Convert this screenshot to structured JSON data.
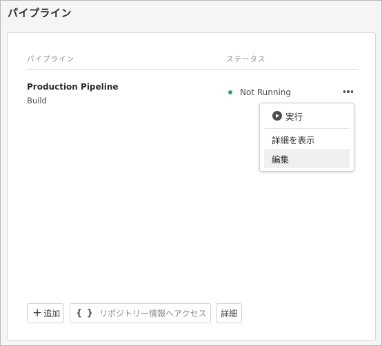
{
  "window": {
    "title": "パイプライン"
  },
  "table": {
    "columns": [
      "パイプライン",
      "ステータス"
    ]
  },
  "pipeline": {
    "name": "Production Pipeline",
    "subtitle": "Build",
    "status": "Not Running",
    "status_color": "#2d9d78"
  },
  "menu": {
    "run": "実行",
    "details": "詳細を表示",
    "edit": "編集",
    "hovered": "編集"
  },
  "footer": {
    "add_label": "追加",
    "repo_label": "リポジトリー情報へアクセス",
    "more_label": "詳細"
  },
  "icons": {
    "more": "ellipsis-icon",
    "run": "play-icon",
    "add": "plus-icon",
    "repo": "braces-icon"
  }
}
